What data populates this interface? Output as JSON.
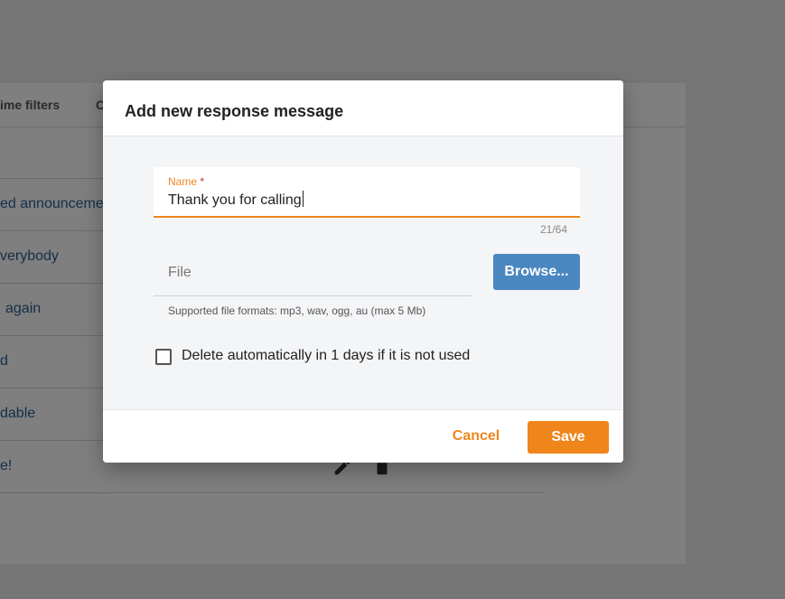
{
  "background": {
    "tabs": [
      "ime filters",
      "C"
    ],
    "rows": [
      "ed announcemer",
      "verybody",
      "again",
      "d",
      "dable",
      "e!"
    ],
    "row_icons": [
      "pencil-icon",
      "trash-icon"
    ]
  },
  "dialog": {
    "title": "Add new response message",
    "name_field": {
      "label": "Name",
      "required_mark": "*",
      "value": "Thank you for calling",
      "counter": "21/64"
    },
    "file_field": {
      "placeholder": "File",
      "browse_label": "Browse...",
      "hint": "Supported file formats: mp3, wav, ogg, au (max 5 Mb)"
    },
    "auto_delete": {
      "checked": false,
      "label": "Delete automatically in 1 days if it is not used"
    },
    "footer": {
      "cancel_label": "Cancel",
      "save_label": "Save"
    }
  },
  "colors": {
    "accent": "#f0851c",
    "browse": "#4a87c0",
    "required": "#d32f2f",
    "link": "#2b5f93"
  }
}
